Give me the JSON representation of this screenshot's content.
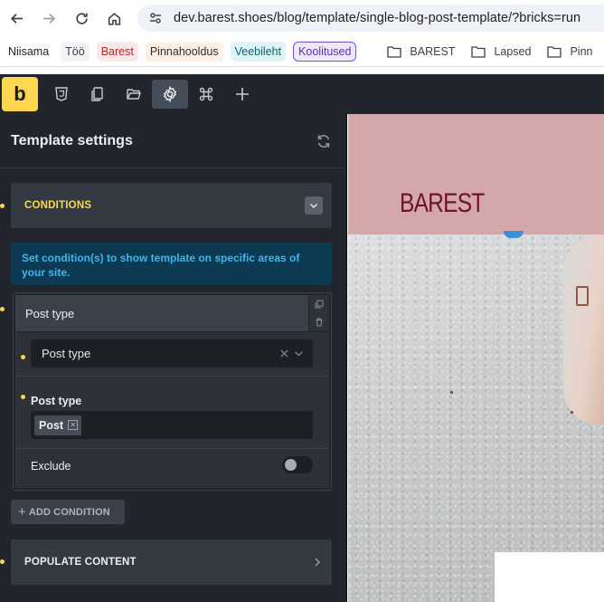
{
  "browser": {
    "url": "dev.barest.shoes/blog/template/single-blog-post-template/?bricks=run",
    "bookmarks": [
      {
        "label": "Niisama",
        "style": "plain"
      },
      {
        "label": "Töö",
        "style": "grey"
      },
      {
        "label": "Barest",
        "style": "red"
      },
      {
        "label": "Pinnahooldus",
        "style": "peach"
      },
      {
        "label": "Veebileht",
        "style": "cyan"
      },
      {
        "label": "Koolitused",
        "style": "purple"
      }
    ],
    "folders": [
      "BAREST",
      "Lapsed",
      "Pinn"
    ]
  },
  "toolbar": {
    "logo": "b",
    "icons": [
      "css-icon",
      "pages-icon",
      "folder-icon",
      "settings-icon",
      "command-icon",
      "add-icon"
    ],
    "active": "settings-icon"
  },
  "panel": {
    "title": "Template settings",
    "conditions": {
      "label": "CONDITIONS",
      "info": "Set condition(s) to show template on specific areas of your site.",
      "condition": {
        "header": "Post type",
        "select_value": "Post type",
        "field_label": "Post type",
        "tags": [
          "Post"
        ],
        "exclude_label": "Exclude",
        "exclude_on": false
      },
      "add_label": "ADD CONDITION"
    },
    "populate": {
      "label": "POPULATE CONTENT"
    }
  },
  "preview": {
    "brand": "BAREST"
  },
  "colors": {
    "accent": "#ffd64f",
    "panel_bg": "#22262c",
    "info_bg": "#0b3a52",
    "info_text": "#3fb6ef",
    "header_pink": "#d4a8a8",
    "brand_color": "#6e1525"
  }
}
